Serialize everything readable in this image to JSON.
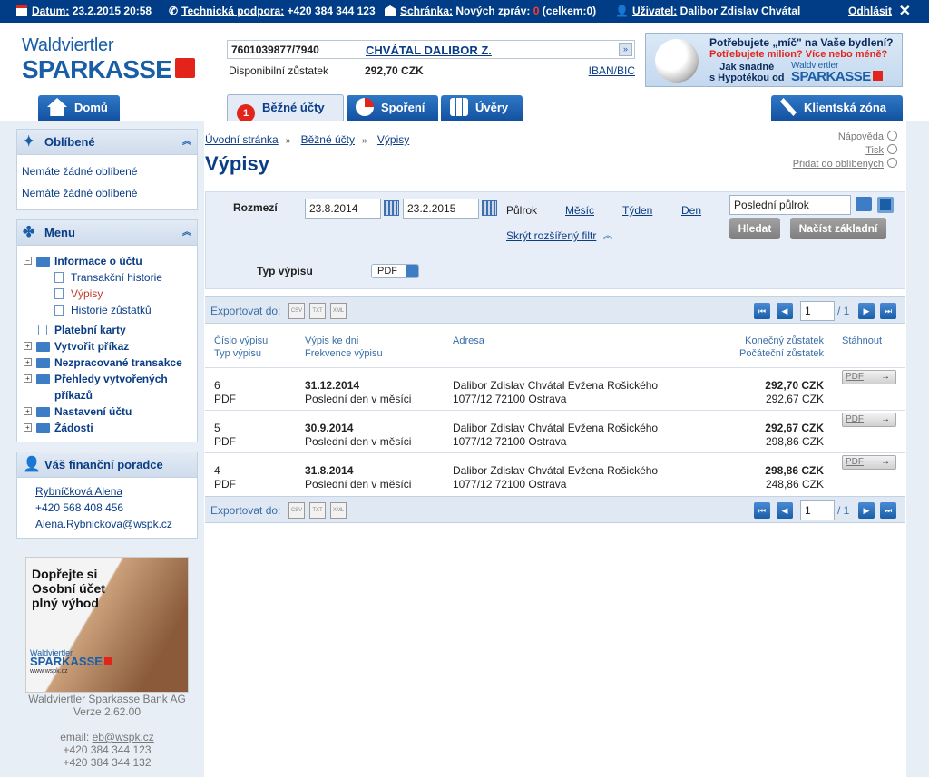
{
  "topbar": {
    "datum_label": "Datum:",
    "datum_value": "23.2.2015 20:58",
    "support_label": "Technická podpora:",
    "support_value": "+420 384 344 123",
    "inbox_label": "Schránka:",
    "inbox_text": "Nových zpráv:",
    "inbox_new": "0",
    "inbox_total": "(celkem:0)",
    "user_label": "Uživatel:",
    "user_value": "Dalibor Zdislav Chvátal",
    "logout": "Odhlásit",
    "close": "✕"
  },
  "logo": {
    "line1": "Waldviertler",
    "line2": "SPARKASSE"
  },
  "account": {
    "number": "7601039877/7940",
    "owner": "CHVÁTAL DALIBOR Z.",
    "balance_label": "Disponibilní zůstatek",
    "balance": "292,70 CZK",
    "iban_link": "IBAN/BIC"
  },
  "banner": {
    "line1": "Potřebujete „míč\" na Vaše bydlení?",
    "line2": "Potřebujete milion? Více nebo méně?",
    "line3a": "Jak snadné",
    "line3b": "s Hypotékou od",
    "logo_small": "Waldviertler",
    "logo_big": "SPARKASSE"
  },
  "tabs": {
    "home": "Domů",
    "current": "Běžné účty",
    "current_badge": "1",
    "savings": "Spoření",
    "loans": "Úvěry",
    "client": "Klientská zóna"
  },
  "sidebar": {
    "favorites": {
      "title": "Oblíbené",
      "items": [
        "Nemáte žádné oblíbené",
        "Nemáte žádné oblíbené"
      ]
    },
    "menu": {
      "title": "Menu",
      "info": "Informace o účtu",
      "sub": [
        "Transakční historie",
        "Výpisy",
        "Historie zůstatků"
      ],
      "items": [
        "Platební karty",
        "Vytvořit příkaz",
        "Nezpracované transakce",
        "Přehledy vytvořených",
        "příkazů",
        "Nastavení účtu",
        "Žádosti"
      ]
    },
    "advisor": {
      "title": "Váš finanční poradce",
      "name": "Rybníčková Alena",
      "phone": "+420 568 408 456",
      "email": "Alena.Rybnickova@wspk.cz"
    },
    "ad": {
      "line1": "Dopřejte si",
      "line2": "Osobní účet",
      "line3": "plný výhod",
      "logo_small": "Waldviertler",
      "logo_big": "SPARKASSE",
      "web": "www.wspk.cz"
    },
    "footer": {
      "bank": "Waldviertler Sparkasse Bank AG",
      "version": "Verze 2.62.00",
      "email_label": "email:",
      "email": "eb@wspk.cz",
      "phone1": "+420 384 344 123",
      "phone2": "+420 384 344 132"
    }
  },
  "breadcrumb": [
    "Úvodní stránka",
    "Běžné účty",
    "Výpisy"
  ],
  "help": {
    "napoveda": "Nápověda",
    "tisk": "Tisk",
    "fav": "Přidat do oblíbených"
  },
  "page_title": "Výpisy",
  "filter": {
    "range_label": "Rozmezí",
    "date_from": "23.8.2014",
    "date_to": "23.2.2015",
    "p_halfyear": "Půlrok",
    "p_month": "Měsíc",
    "p_week": "Týden",
    "p_day": "Den",
    "hide_filter": "Skrýt rozšířený filtr",
    "saved_filter": "Poslední půlrok",
    "search": "Hledat",
    "load_basic": "Načíst základní",
    "type_label": "Typ výpisu",
    "type_value": "PDF"
  },
  "export": {
    "label": "Exportovat do:",
    "formats": [
      "CSV",
      "TXT",
      "XML"
    ],
    "page": "1",
    "of": "/ 1"
  },
  "table": {
    "h_num1": "Číslo výpisu",
    "h_num2": "Typ výpisu",
    "h_date1": "Výpis ke dni",
    "h_date2": "Frekvence výpisu",
    "h_addr": "Adresa",
    "h_bal1": "Konečný zůstatek",
    "h_bal2": "Počáteční zůstatek",
    "h_dl": "Stáhnout",
    "rows": [
      {
        "num": "6",
        "type": "PDF",
        "date": "31.12.2014",
        "freq": "Poslední den v měsíci",
        "addr1": "Dalibor Zdislav Chvátal Evžena Rošického",
        "addr2": "1077/12 72100 Ostrava",
        "end": "292,70 CZK",
        "start": "292,67 CZK",
        "dl": "PDF"
      },
      {
        "num": "5",
        "type": "PDF",
        "date": "30.9.2014",
        "freq": "Poslední den v měsíci",
        "addr1": "Dalibor Zdislav Chvátal Evžena Rošického",
        "addr2": "1077/12 72100 Ostrava",
        "end": "292,67 CZK",
        "start": "298,86 CZK",
        "dl": "PDF"
      },
      {
        "num": "4",
        "type": "PDF",
        "date": "31.8.2014",
        "freq": "Poslední den v měsíci",
        "addr1": "Dalibor Zdislav Chvátal Evžena Rošického",
        "addr2": "1077/12 72100 Ostrava",
        "end": "298,86 CZK",
        "start": "248,86 CZK",
        "dl": "PDF"
      }
    ]
  },
  "colors": {
    "brand": "#003d86",
    "accent_red": "#e3241b",
    "link": "#0a3d86"
  }
}
